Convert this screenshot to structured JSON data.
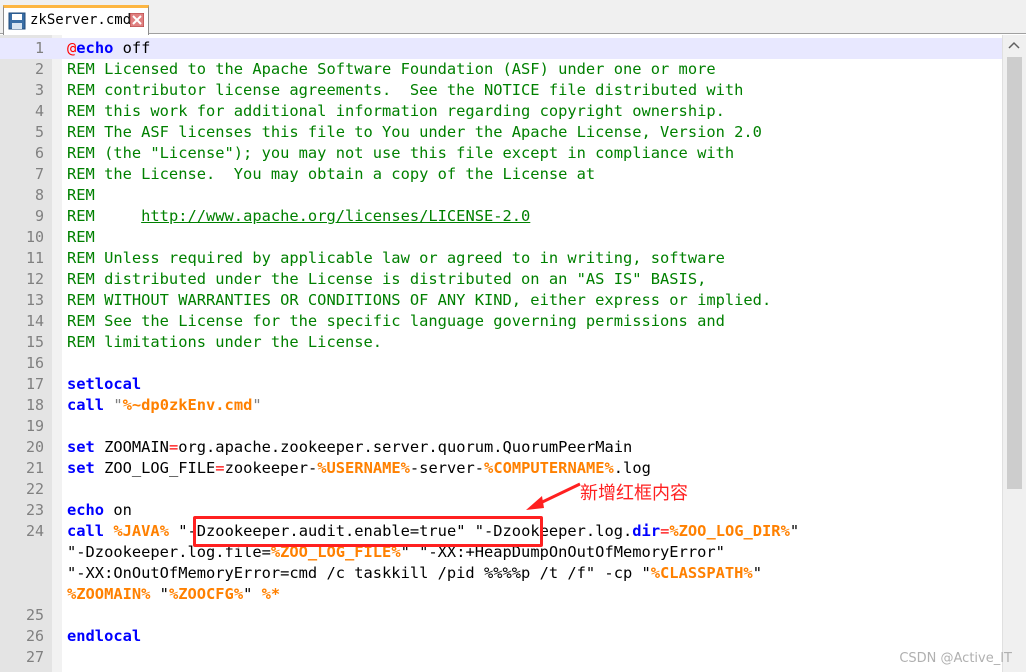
{
  "tab": {
    "title": "zkServer.cmd",
    "icon": "save-icon"
  },
  "colors": {
    "comment": "#008000",
    "keyword": "#0000ff",
    "variable": "#ff8000",
    "operator": "#ff0000",
    "annotation": "#ff2020",
    "tab_accent": "#fdb642"
  },
  "editor": {
    "lines": [
      {
        "num": "1",
        "current": true,
        "segments": [
          {
            "t": "@",
            "c": "c-at"
          },
          {
            "t": "echo",
            "c": "c-kw"
          },
          {
            "t": " off",
            "c": "c-plain"
          }
        ]
      },
      {
        "num": "2",
        "segments": [
          {
            "t": "REM Licensed to the Apache Software Foundation (ASF) under one or more",
            "c": "c-rem"
          }
        ]
      },
      {
        "num": "3",
        "segments": [
          {
            "t": "REM contributor license agreements.  See the NOTICE file distributed with",
            "c": "c-rem"
          }
        ]
      },
      {
        "num": "4",
        "segments": [
          {
            "t": "REM this work for additional information regarding copyright ownership.",
            "c": "c-rem"
          }
        ]
      },
      {
        "num": "5",
        "segments": [
          {
            "t": "REM The ASF licenses this file to You under the Apache License, Version 2.0",
            "c": "c-rem"
          }
        ]
      },
      {
        "num": "6",
        "segments": [
          {
            "t": "REM (the \"License\"); you may not use this file except in compliance with",
            "c": "c-rem"
          }
        ]
      },
      {
        "num": "7",
        "segments": [
          {
            "t": "REM the License.  You may obtain a copy of the License at",
            "c": "c-rem"
          }
        ]
      },
      {
        "num": "8",
        "segments": [
          {
            "t": "REM",
            "c": "c-rem"
          }
        ]
      },
      {
        "num": "9",
        "segments": [
          {
            "t": "REM     ",
            "c": "c-rem"
          },
          {
            "t": "http://www.apache.org/licenses/LICENSE-2.0",
            "c": "c-link"
          }
        ]
      },
      {
        "num": "10",
        "segments": [
          {
            "t": "REM",
            "c": "c-rem"
          }
        ]
      },
      {
        "num": "11",
        "segments": [
          {
            "t": "REM Unless required by applicable law or agreed to in writing, software",
            "c": "c-rem"
          }
        ]
      },
      {
        "num": "12",
        "segments": [
          {
            "t": "REM distributed under the License is distributed on an \"AS IS\" BASIS,",
            "c": "c-rem"
          }
        ]
      },
      {
        "num": "13",
        "segments": [
          {
            "t": "REM WITHOUT WARRANTIES OR CONDITIONS OF ANY KIND, either express or implied.",
            "c": "c-rem"
          }
        ]
      },
      {
        "num": "14",
        "segments": [
          {
            "t": "REM See the License for the specific language governing permissions and",
            "c": "c-rem"
          }
        ]
      },
      {
        "num": "15",
        "segments": [
          {
            "t": "REM limitations under the License.",
            "c": "c-rem"
          }
        ]
      },
      {
        "num": "16",
        "segments": []
      },
      {
        "num": "17",
        "segments": [
          {
            "t": "setlocal",
            "c": "c-kw"
          }
        ]
      },
      {
        "num": "18",
        "segments": [
          {
            "t": "call",
            "c": "c-kw"
          },
          {
            "t": " \"",
            "c": "c-str"
          },
          {
            "t": "%~dp0zkEnv.cmd",
            "c": "c-var"
          },
          {
            "t": "\"",
            "c": "c-str"
          }
        ]
      },
      {
        "num": "19",
        "segments": []
      },
      {
        "num": "20",
        "segments": [
          {
            "t": "set",
            "c": "c-kw"
          },
          {
            "t": " ZOOMAIN",
            "c": "c-plain"
          },
          {
            "t": "=",
            "c": "c-op"
          },
          {
            "t": "org.apache.zookeeper.server.quorum.QuorumPeerMain",
            "c": "c-plain"
          }
        ]
      },
      {
        "num": "21",
        "segments": [
          {
            "t": "set",
            "c": "c-kw"
          },
          {
            "t": " ZOO_LOG_FILE",
            "c": "c-plain"
          },
          {
            "t": "=",
            "c": "c-op"
          },
          {
            "t": "zookeeper-",
            "c": "c-plain"
          },
          {
            "t": "%USERNAME%",
            "c": "c-var"
          },
          {
            "t": "-server-",
            "c": "c-plain"
          },
          {
            "t": "%COMPUTERNAME%",
            "c": "c-var"
          },
          {
            "t": ".log",
            "c": "c-plain"
          }
        ]
      },
      {
        "num": "22",
        "segments": []
      },
      {
        "num": "23",
        "segments": [
          {
            "t": "echo",
            "c": "c-kw"
          },
          {
            "t": " on",
            "c": "c-plain"
          }
        ]
      },
      {
        "num": "24",
        "segments": [
          {
            "t": "call",
            "c": "c-kw"
          },
          {
            "t": " ",
            "c": "c-plain"
          },
          {
            "t": "%JAVA%",
            "c": "c-var"
          },
          {
            "t": " \"-Dzookeeper.audit.enable=true\" \"-Dzookeeper.log.",
            "c": "c-plain"
          },
          {
            "t": "dir",
            "c": "c-kw"
          },
          {
            "t": "=",
            "c": "c-op"
          },
          {
            "t": "%ZOO_LOG_DIR%",
            "c": "c-var"
          },
          {
            "t": "\"",
            "c": "c-plain"
          }
        ]
      },
      {
        "num": "",
        "segments": [
          {
            "t": "\"-Dzookeeper.log.file=",
            "c": "c-plain"
          },
          {
            "t": "%ZOO_LOG_FILE%",
            "c": "c-var"
          },
          {
            "t": "\" \"-XX:+HeapDumpOnOutOfMemoryError\"",
            "c": "c-plain"
          }
        ]
      },
      {
        "num": "",
        "segments": [
          {
            "t": "\"-XX:OnOutOfMemoryError=cmd /c taskkill /pid %%%%p /t /f\" -cp \"",
            "c": "c-plain"
          },
          {
            "t": "%CLASSPATH%",
            "c": "c-var"
          },
          {
            "t": "\"",
            "c": "c-plain"
          }
        ]
      },
      {
        "num": "",
        "segments": [
          {
            "t": "%ZOOMAIN%",
            "c": "c-var"
          },
          {
            "t": " \"",
            "c": "c-plain"
          },
          {
            "t": "%ZOOCFG%",
            "c": "c-var"
          },
          {
            "t": "\" ",
            "c": "c-plain"
          },
          {
            "t": "%*",
            "c": "c-var"
          }
        ]
      },
      {
        "num": "25",
        "segments": []
      },
      {
        "num": "26",
        "segments": [
          {
            "t": "endlocal",
            "c": "c-kw"
          }
        ]
      },
      {
        "num": "27",
        "segments": []
      }
    ]
  },
  "annotation": {
    "text": "新增红框内容"
  },
  "watermark": {
    "text": "CSDN @Active_IT"
  }
}
